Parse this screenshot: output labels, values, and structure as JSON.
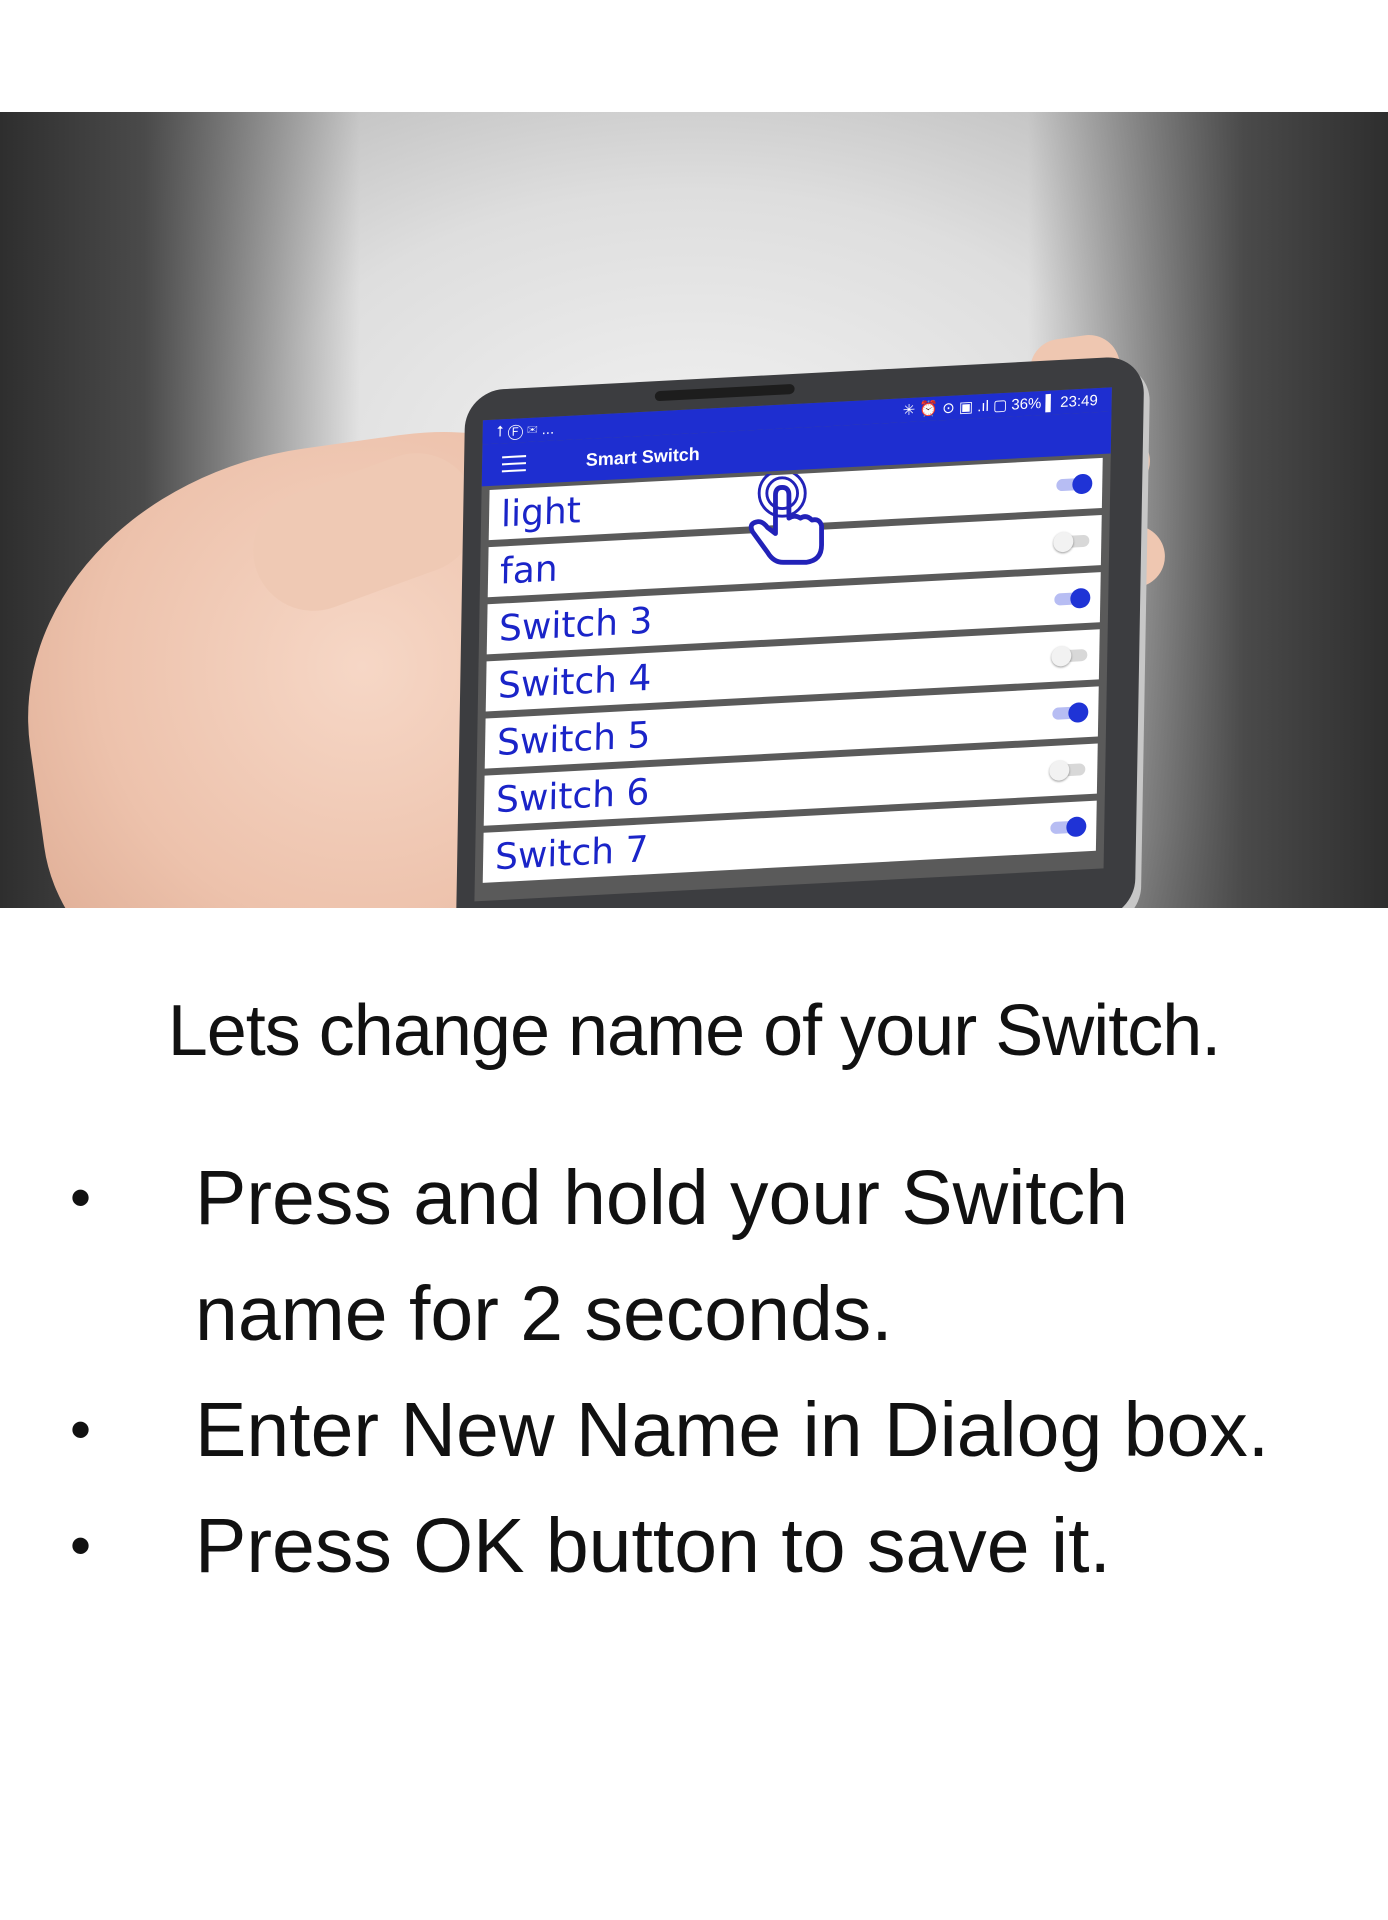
{
  "phone": {
    "status_bar": {
      "left_icons": "⭡ Ⓕ ✉ ...",
      "right_text": "✳ ⏰ ⊙ ▣ .ıl ▢ 36% ▌ 23:49"
    },
    "app_bar": {
      "menu_icon": "hamburger-menu-icon",
      "title": "Smart Switch"
    },
    "switches": [
      {
        "label": "light",
        "on": true
      },
      {
        "label": "fan",
        "on": false
      },
      {
        "label": "Switch 3",
        "on": true
      },
      {
        "label": "Switch 4",
        "on": false
      },
      {
        "label": "Switch 5",
        "on": true
      },
      {
        "label": "Switch 6",
        "on": false
      },
      {
        "label": "Switch 7",
        "on": true
      }
    ],
    "touch_icon": "pointing-hand-icon",
    "accent_color": "#1e2ed0"
  },
  "instructions": {
    "heading": "Lets change name of your Switch.",
    "bullets": [
      "Press and hold your Switch name for 2 seconds.",
      "Enter New Name in Dialog box.",
      "Press OK button to save it."
    ]
  }
}
